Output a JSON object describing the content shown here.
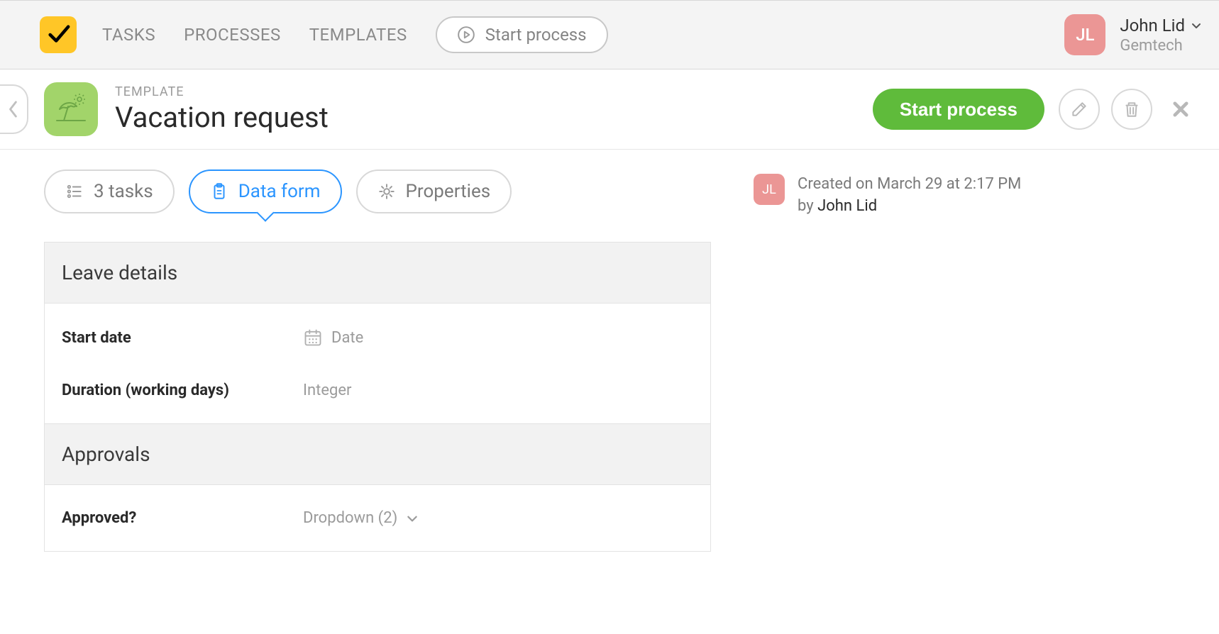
{
  "nav": {
    "tasks": "TASKS",
    "processes": "PROCESSES",
    "templates": "TEMPLATES",
    "start_process": "Start process"
  },
  "user": {
    "initials": "JL",
    "name": "John Lid",
    "org": "Gemtech"
  },
  "template": {
    "eyebrow": "TEMPLATE",
    "title": "Vacation request",
    "start_button": "Start process"
  },
  "tabs": {
    "tasks": "3 tasks",
    "data_form": "Data form",
    "properties": "Properties"
  },
  "form": {
    "sections": [
      {
        "title": "Leave details",
        "fields": [
          {
            "label": "Start date",
            "type_label": "Date",
            "icon": "calendar"
          },
          {
            "label": "Duration (working days)",
            "type_label": "Integer",
            "icon": "none"
          }
        ]
      },
      {
        "title": "Approvals",
        "fields": [
          {
            "label": "Approved?",
            "type_label": "Dropdown (2)",
            "icon": "chevron"
          }
        ]
      }
    ]
  },
  "meta": {
    "created_text": "Created on March 29 at 2:17 PM",
    "by_label": "by ",
    "author": "John Lid",
    "initials": "JL"
  }
}
